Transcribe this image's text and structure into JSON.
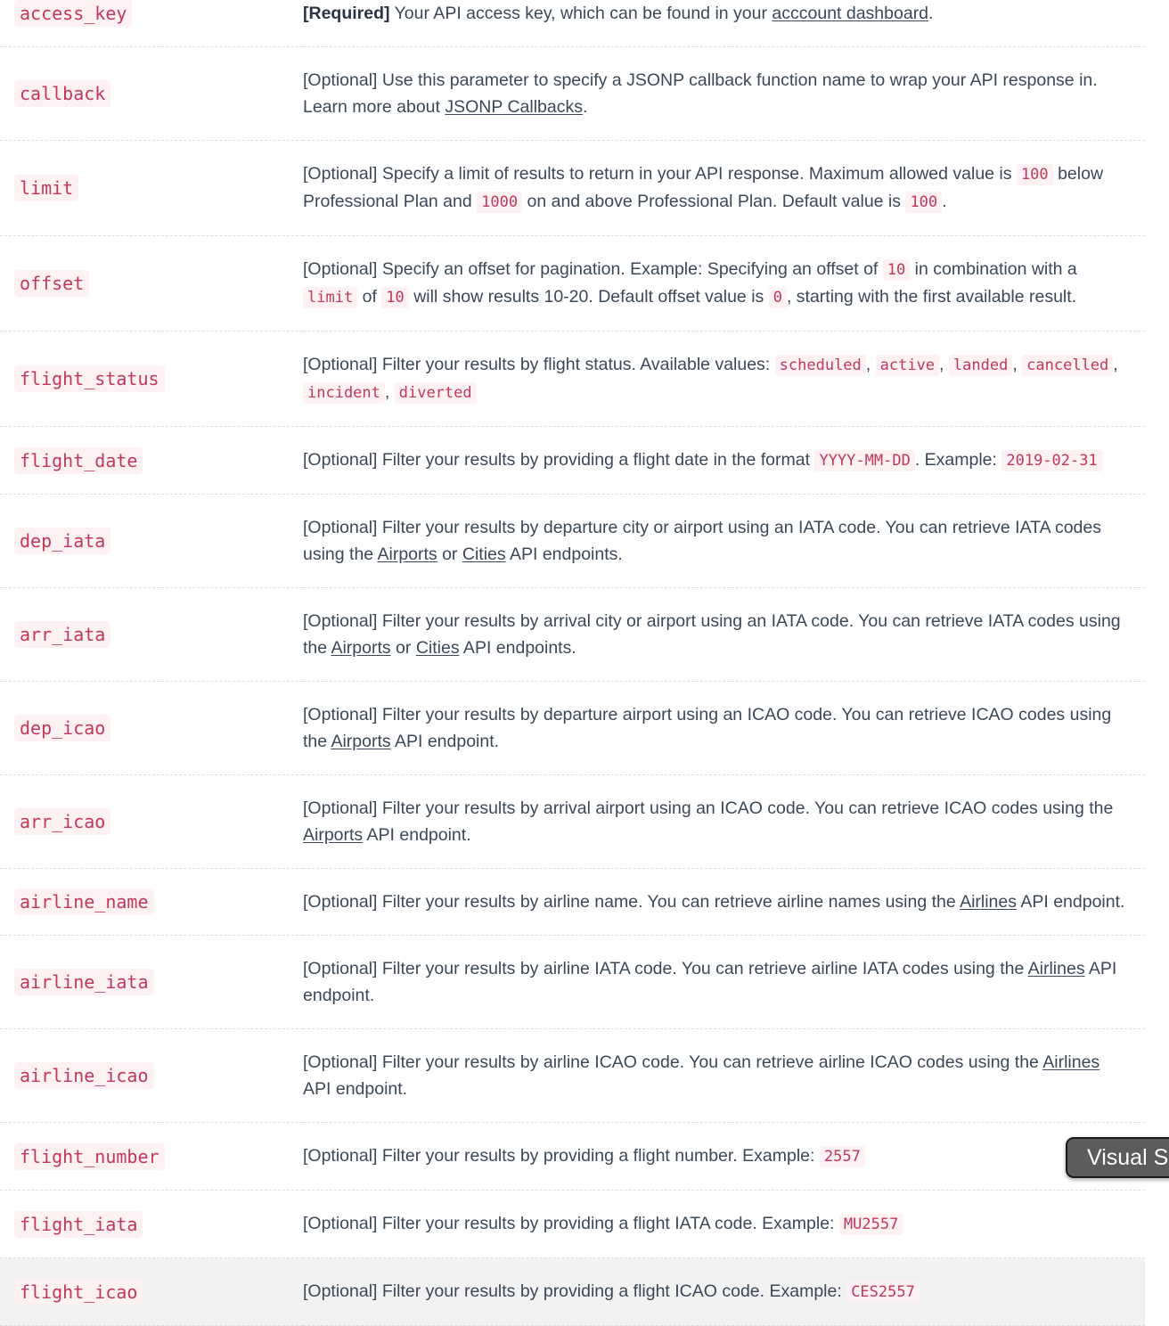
{
  "table": {
    "rows": [
      {
        "name": "access_key",
        "highlighted": false,
        "parts": [
          {
            "t": "req",
            "v": "[Required]"
          },
          {
            "t": "text",
            "v": " Your API access key, which can be found in your "
          },
          {
            "t": "link",
            "v": "acccount dashboard"
          },
          {
            "t": "text",
            "v": "."
          }
        ]
      },
      {
        "name": "callback",
        "highlighted": false,
        "parts": [
          {
            "t": "text",
            "v": "[Optional] Use this parameter to specify a JSONP callback function name to wrap your API response in. Learn more about "
          },
          {
            "t": "link",
            "v": "JSONP Callbacks"
          },
          {
            "t": "text",
            "v": "."
          }
        ]
      },
      {
        "name": "limit",
        "highlighted": false,
        "parts": [
          {
            "t": "text",
            "v": "[Optional] Specify a limit of results to return in your API response. Maximum allowed value is "
          },
          {
            "t": "code",
            "v": "100"
          },
          {
            "t": "text",
            "v": " below Professional Plan and "
          },
          {
            "t": "code",
            "v": "1000"
          },
          {
            "t": "text",
            "v": " on and above Professional Plan. Default value is "
          },
          {
            "t": "code",
            "v": "100"
          },
          {
            "t": "text",
            "v": "."
          }
        ]
      },
      {
        "name": "offset",
        "highlighted": false,
        "parts": [
          {
            "t": "text",
            "v": "[Optional] Specify an offset for pagination. Example: Specifying an offset of "
          },
          {
            "t": "code",
            "v": "10"
          },
          {
            "t": "text",
            "v": " in combination with a "
          },
          {
            "t": "code",
            "v": "limit"
          },
          {
            "t": "text",
            "v": " of "
          },
          {
            "t": "code",
            "v": "10"
          },
          {
            "t": "text",
            "v": " will show results 10-20. Default offset value is "
          },
          {
            "t": "code",
            "v": "0"
          },
          {
            "t": "text",
            "v": ", starting with the first available result."
          }
        ]
      },
      {
        "name": "flight_status",
        "highlighted": false,
        "parts": [
          {
            "t": "text",
            "v": "[Optional] Filter your results by flight status. Available values: "
          },
          {
            "t": "code",
            "v": "scheduled"
          },
          {
            "t": "text",
            "v": ", "
          },
          {
            "t": "code",
            "v": "active"
          },
          {
            "t": "text",
            "v": ", "
          },
          {
            "t": "code",
            "v": "landed"
          },
          {
            "t": "text",
            "v": ", "
          },
          {
            "t": "code",
            "v": "cancelled"
          },
          {
            "t": "text",
            "v": ", "
          },
          {
            "t": "code",
            "v": "incident"
          },
          {
            "t": "text",
            "v": ", "
          },
          {
            "t": "code",
            "v": "diverted"
          }
        ]
      },
      {
        "name": "flight_date",
        "highlighted": false,
        "parts": [
          {
            "t": "text",
            "v": "[Optional] Filter your results by providing a flight date in the format "
          },
          {
            "t": "code",
            "v": "YYYY-MM-DD"
          },
          {
            "t": "text",
            "v": ". Example: "
          },
          {
            "t": "code",
            "v": "2019-02-31"
          }
        ]
      },
      {
        "name": "dep_iata",
        "highlighted": false,
        "parts": [
          {
            "t": "text",
            "v": "[Optional] Filter your results by departure city or airport using an IATA code. You can retrieve IATA codes using the "
          },
          {
            "t": "link",
            "v": "Airports"
          },
          {
            "t": "text",
            "v": " or "
          },
          {
            "t": "link",
            "v": "Cities"
          },
          {
            "t": "text",
            "v": " API endpoints."
          }
        ]
      },
      {
        "name": "arr_iata",
        "highlighted": false,
        "parts": [
          {
            "t": "text",
            "v": "[Optional] Filter your results by arrival city or airport using an IATA code. You can retrieve IATA codes using the "
          },
          {
            "t": "link",
            "v": "Airports"
          },
          {
            "t": "text",
            "v": " or "
          },
          {
            "t": "link",
            "v": "Cities"
          },
          {
            "t": "text",
            "v": " API endpoints."
          }
        ]
      },
      {
        "name": "dep_icao",
        "highlighted": false,
        "parts": [
          {
            "t": "text",
            "v": "[Optional] Filter your results by departure airport using an ICAO code. You can retrieve ICAO codes using the "
          },
          {
            "t": "link",
            "v": "Airports"
          },
          {
            "t": "text",
            "v": " API endpoint."
          }
        ]
      },
      {
        "name": "arr_icao",
        "highlighted": false,
        "parts": [
          {
            "t": "text",
            "v": "[Optional] Filter your results by arrival airport using an ICAO code. You can retrieve ICAO codes using the "
          },
          {
            "t": "link",
            "v": "Airports"
          },
          {
            "t": "text",
            "v": " API endpoint."
          }
        ]
      },
      {
        "name": "airline_name",
        "highlighted": false,
        "parts": [
          {
            "t": "text",
            "v": "[Optional] Filter your results by airline name. You can retrieve airline names using the "
          },
          {
            "t": "link",
            "v": "Airlines"
          },
          {
            "t": "text",
            "v": " API endpoint."
          }
        ]
      },
      {
        "name": "airline_iata",
        "highlighted": false,
        "parts": [
          {
            "t": "text",
            "v": "[Optional] Filter your results by airline IATA code. You can retrieve airline IATA codes using the "
          },
          {
            "t": "link",
            "v": "Airlines"
          },
          {
            "t": "text",
            "v": " API endpoint."
          }
        ]
      },
      {
        "name": "airline_icao",
        "highlighted": false,
        "parts": [
          {
            "t": "text",
            "v": "[Optional] Filter your results by airline ICAO code. You can retrieve airline ICAO codes using the "
          },
          {
            "t": "link",
            "v": "Airlines"
          },
          {
            "t": "text",
            "v": " API endpoint."
          }
        ]
      },
      {
        "name": "flight_number",
        "highlighted": false,
        "parts": [
          {
            "t": "text",
            "v": "[Optional] Filter your results by providing a flight number. Example: "
          },
          {
            "t": "code",
            "v": "2557"
          }
        ]
      },
      {
        "name": "flight_iata",
        "highlighted": false,
        "parts": [
          {
            "t": "text",
            "v": "[Optional] Filter your results by providing a flight IATA code. Example: "
          },
          {
            "t": "code",
            "v": "MU2557"
          }
        ]
      },
      {
        "name": "flight_icao",
        "highlighted": true,
        "parts": [
          {
            "t": "text",
            "v": "[Optional] Filter your results by providing a flight ICAO code. Example: "
          },
          {
            "t": "code",
            "v": "CES2557"
          }
        ]
      }
    ]
  },
  "overlay": {
    "visual_button_label": "Visual S"
  },
  "colors": {
    "param_name_text": "#c0395a",
    "param_name_bg": "#fdf1f4",
    "body_text": "#3c4858",
    "row_divider": "#d9dde3",
    "highlight_row_bg": "#f2f2f2",
    "overlay_button_bg": "#5c5c5c"
  }
}
